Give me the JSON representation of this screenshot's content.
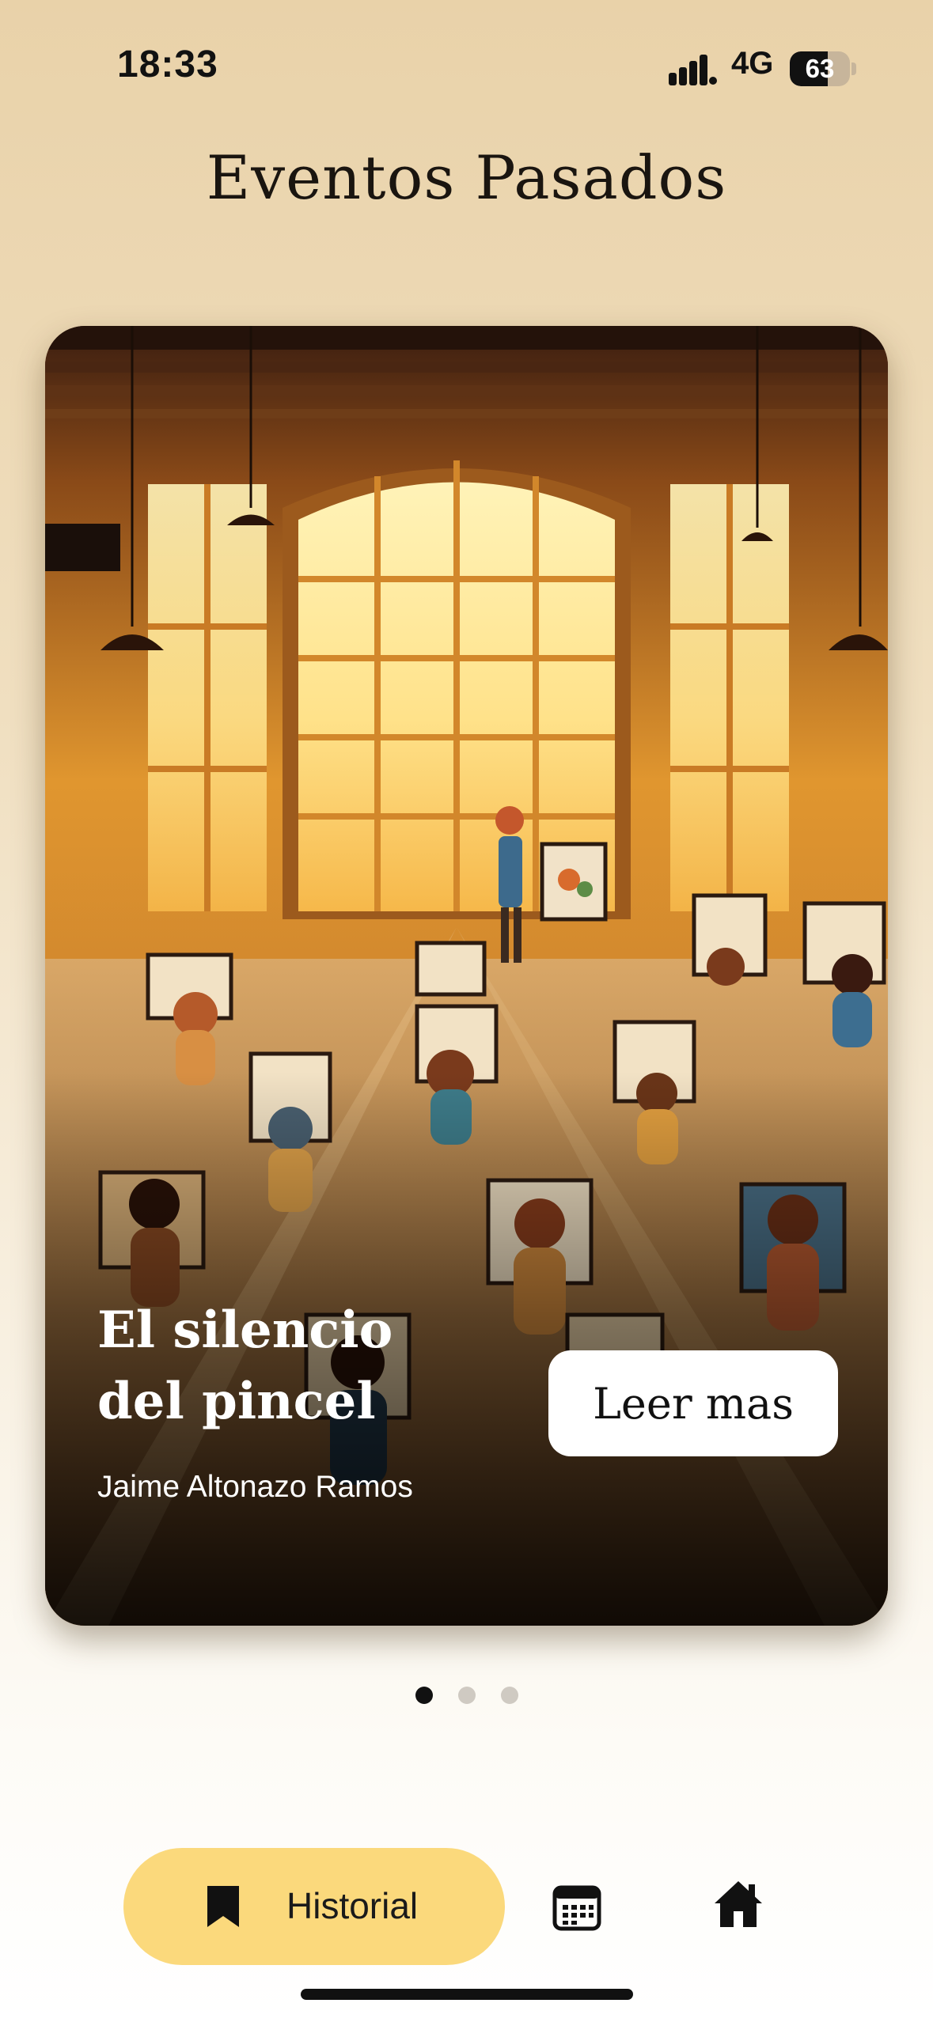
{
  "status_bar": {
    "time": "18:33",
    "network": "4G",
    "battery_percent": "63",
    "battery_level": 0.63
  },
  "header": {
    "title": "Eventos Pasados"
  },
  "card": {
    "title_line1": "El silencio",
    "title_line2": "del pincel",
    "author": "Jaime Altonazo Ramos",
    "button_label": "Leer mas"
  },
  "pagination": {
    "count": 3,
    "active_index": 0
  },
  "bottom_nav": {
    "active_label": "Historial",
    "items": [
      {
        "icon": "bookmark-icon",
        "label": "Historial",
        "active": true
      },
      {
        "icon": "calendar-icon",
        "label": "",
        "active": false
      },
      {
        "icon": "home-icon",
        "label": "",
        "active": false
      }
    ],
    "active_color": "#fbd97c"
  }
}
